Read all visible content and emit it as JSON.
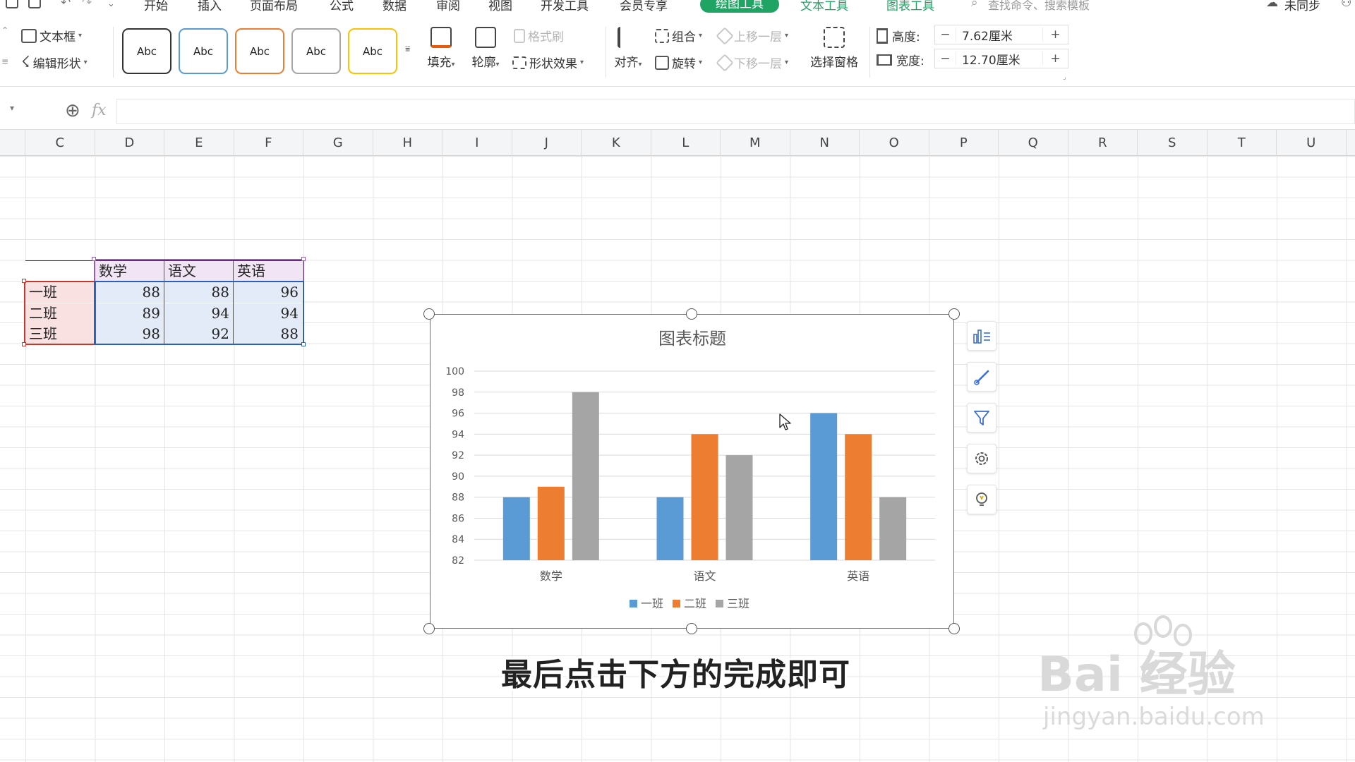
{
  "menu": {
    "items": [
      "开始",
      "插入",
      "页面布局",
      "公式",
      "数据",
      "审阅",
      "视图",
      "开发工具",
      "会员专享"
    ],
    "active_tab": "绘图工具",
    "context_tabs": [
      "文本工具",
      "图表工具"
    ],
    "search_placeholder": "查找命令、搜索模板",
    "sync_status": "未同步"
  },
  "ribbon": {
    "text_box": "文本框",
    "edit_shape": "编辑形状",
    "style_presets": [
      "Abc",
      "Abc",
      "Abc",
      "Abc",
      "Abc"
    ],
    "style_preset_colors": [
      "#333333",
      "#5b9bd5",
      "#ed7d31",
      "#a5a5a5",
      "#ffc000"
    ],
    "fill": "填充",
    "outline": "轮廓",
    "format_painter": "格式刷",
    "shape_effects": "形状效果",
    "align": "对齐",
    "group": "组合",
    "rotate": "旋转",
    "bring_forward": "上移一层",
    "send_backward": "下移一层",
    "selection_pane": "选择窗格",
    "height_label": "高度:",
    "height_value": "7.62厘米",
    "width_label": "宽度:",
    "width_value": "12.70厘米"
  },
  "formula_bar": {
    "fx": "fx",
    "value": ""
  },
  "columns": [
    "C",
    "D",
    "E",
    "F",
    "G",
    "H",
    "I",
    "J",
    "K",
    "L",
    "M",
    "N",
    "O",
    "P",
    "Q",
    "R",
    "S",
    "T",
    "U"
  ],
  "table": {
    "headers": [
      "数学",
      "语文",
      "英语"
    ],
    "rows": [
      {
        "label": "一班",
        "values": [
          "88",
          "88",
          "96"
        ]
      },
      {
        "label": "二班",
        "values": [
          "89",
          "94",
          "94"
        ]
      },
      {
        "label": "三班",
        "values": [
          "98",
          "92",
          "88"
        ]
      }
    ]
  },
  "chart_data": {
    "type": "bar",
    "title": "图表标题",
    "categories": [
      "数学",
      "语文",
      "英语"
    ],
    "series": [
      {
        "name": "一班",
        "values": [
          88,
          88,
          96
        ],
        "color": "#5b9bd5"
      },
      {
        "name": "二班",
        "values": [
          89,
          94,
          94
        ],
        "color": "#ed7d31"
      },
      {
        "name": "三班",
        "values": [
          98,
          92,
          88
        ],
        "color": "#a5a5a5"
      }
    ],
    "ylim": [
      82,
      100
    ],
    "yticks": [
      82,
      84,
      86,
      88,
      90,
      92,
      94,
      96,
      98,
      100
    ],
    "grid": true,
    "legend": "bottom",
    "xlabel": "",
    "ylabel": ""
  },
  "side_tools": [
    "chart-elements-icon",
    "chart-style-icon",
    "chart-filter-icon",
    "settings-icon",
    "lightbulb-icon"
  ],
  "overlay": {
    "subtitle": "最后点击下方的完成即可",
    "watermark_brand": "Bai 经验",
    "watermark_url": "jingyan.baidu.com"
  }
}
